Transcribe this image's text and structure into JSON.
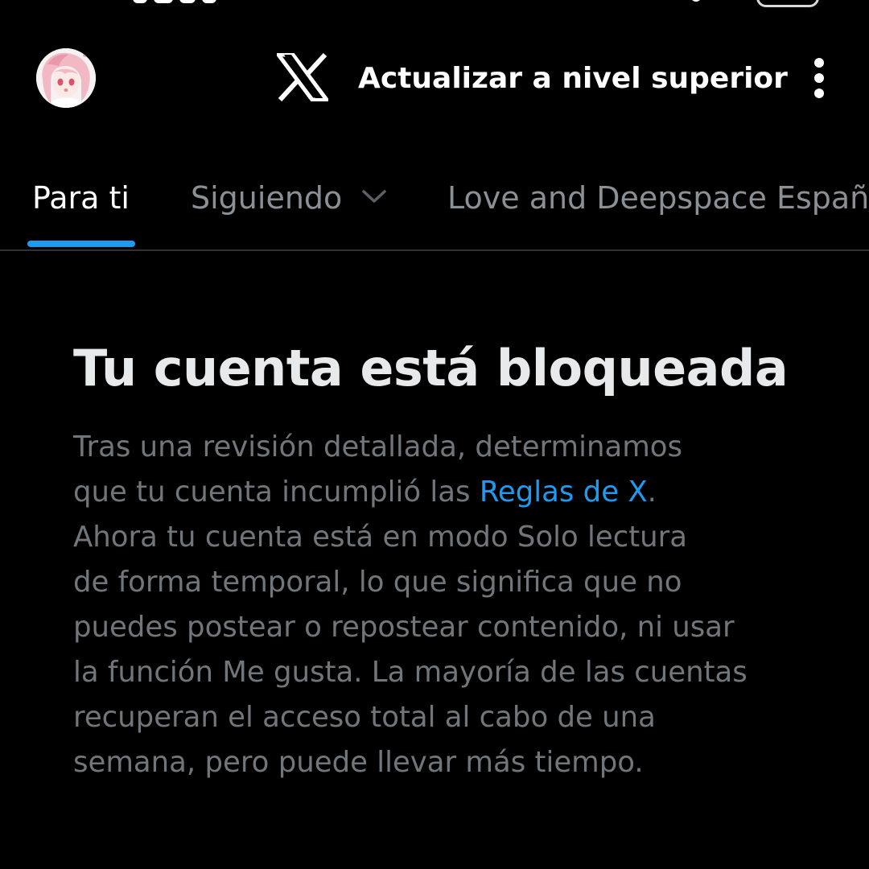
{
  "header": {
    "avatar_alt": "Profile avatar",
    "logo": "x-logo-icon",
    "upgrade_label": "Actualizar a nivel superior",
    "more_icon": "more-vertical-icon"
  },
  "tabs": [
    {
      "label": "Para ti",
      "active": true
    },
    {
      "label": "Siguiendo",
      "active": false,
      "icon": "chevron-down-icon"
    },
    {
      "label": "Love and Deepspace Españ",
      "active": false
    }
  ],
  "notice": {
    "title": "Tu cuenta está bloqueada",
    "lines": [
      "Tras una revisión detallada, determinamos",
      "que tu cuenta incumplió las ",
      "Ahora tu cuenta está en modo Solo lectura",
      "de forma temporal, lo que significa que no",
      "puedes postear o repostear contenido, ni usar",
      "la función Me gusta. La mayoría de las cuentas",
      "recuperan el acceso total al cabo de una",
      "semana, pero puede llevar más tiempo."
    ],
    "rules_link": "Reglas de X",
    "rules_link_suffix": "."
  },
  "colors": {
    "background": "#000000",
    "accent": "#1d9bf0",
    "text_primary": "#e7e9ea",
    "text_secondary": "#71767b",
    "divider": "#2f3336"
  }
}
